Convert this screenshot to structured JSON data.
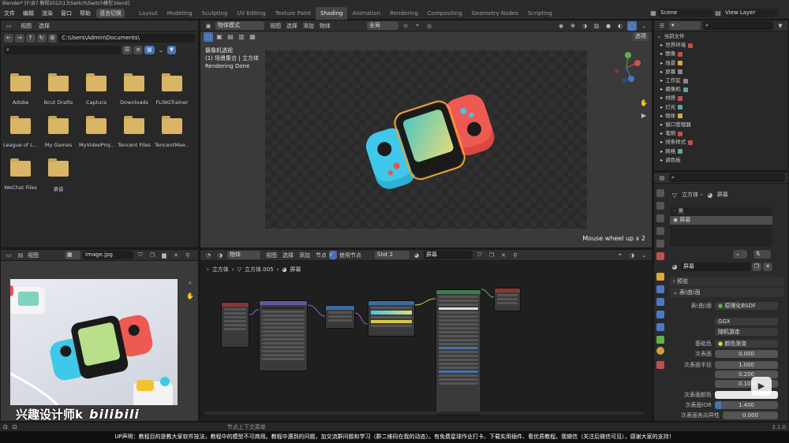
{
  "titlebar": {
    "text": "Blender* [F:\\B7 教程2022\\13\\Switch\\Switch模型.blend]"
  },
  "menu": {
    "items": [
      "文件",
      "编辑",
      "渲染",
      "窗口",
      "帮助"
    ],
    "switch_label": "语言切换"
  },
  "workspaces": [
    "Layout",
    "Modeling",
    "Sculpting",
    "UV Editing",
    "Texture Paint",
    "Shading",
    "Animation",
    "Rendering",
    "Compositing",
    "Geometry Nodes",
    "Scripting"
  ],
  "active_workspace": "Shading",
  "scene": {
    "name": "Scene",
    "view_layer": "View Layer"
  },
  "file_browser": {
    "menu": [
      "视图",
      "选择"
    ],
    "path": "C:\\Users\\Admin\\Documents\\",
    "folders": [
      "Adobe",
      "Bcut Drafts",
      "Captura",
      "Downloads",
      "FLiNGTrainer",
      "League of L...",
      "My Games",
      "MyVideoProj...",
      "Tencent Files",
      "TencentMee...",
      "WeChat Files",
      "录音"
    ]
  },
  "viewport": {
    "mode": "物体模式",
    "menu": [
      "视图",
      "选择",
      "添加",
      "物体"
    ],
    "transform": "全局",
    "options": "选项",
    "camera_label": "摄像机透视",
    "collection_label": "(1) 场景集合 | 立方体",
    "status": "Rendering Done",
    "hint": "Mouse wheel up x 2"
  },
  "outliner": {
    "root": "当前文件",
    "items": [
      "世界环境",
      "图像",
      "场景",
      "屏幕",
      "工作区",
      "摄像机",
      "材质",
      "灯光",
      "物体",
      "窗口管理器",
      "笔刷",
      "线条样式",
      "网格",
      "调色板"
    ]
  },
  "properties": {
    "breadcrumb": [
      "立方体",
      "屏幕"
    ],
    "materials": [
      "黑",
      "屏幕"
    ],
    "material_name": "屏幕",
    "preview": "预览",
    "surface_section": "表(曲)面",
    "surface_label": "表(曲)面",
    "surface_value": "原理化BSDF",
    "distribution": "GGX",
    "subsurface_method": "随机游走",
    "rows": [
      {
        "label": "基础色",
        "value": "颜色渐变"
      },
      {
        "label": "次表面",
        "value": "0.000"
      },
      {
        "label": "次表面半径",
        "value": "1.000"
      },
      {
        "label": "",
        "value": "0.200"
      },
      {
        "label": "",
        "value": "0.100"
      },
      {
        "label": "次表面颜色",
        "value": ""
      },
      {
        "label": "次表面IOR",
        "value": "1.400"
      },
      {
        "label": "次表面各向异性",
        "value": "0.000"
      }
    ]
  },
  "image_editor": {
    "menu": [
      "视图"
    ],
    "image_name": "Image.jpg"
  },
  "node_editor": {
    "mode": "物体",
    "menu": [
      "视图",
      "选择",
      "添加",
      "节点"
    ],
    "use_nodes": "使用节点",
    "slot": "Slot 2",
    "material": "屏幕",
    "breadcrumb": [
      "立方体",
      "立方体.005",
      "屏幕"
    ]
  },
  "watermark": {
    "author": "兴趣设计师k",
    "site": "bilibili"
  },
  "statusbar": {
    "hint": "节点上下文菜单",
    "version": "3.1.0"
  },
  "notice": {
    "text": "UP声明：教程目的是教大家软件技法，教程中的模型不可商用。教程中遇到的问题，加交流群问题和学习（群二维码在我的动态）。有免费星球作业打卡、下载实用插件、看优质教程。我微信（关注后微信可见），感谢大家的支持！"
  },
  "colors": {
    "accent": "#4772b3",
    "folder": "#d9b565",
    "switch_red": "#e8544e",
    "switch_blue": "#2ec0e0",
    "notice_yellow": "#ffd700"
  }
}
